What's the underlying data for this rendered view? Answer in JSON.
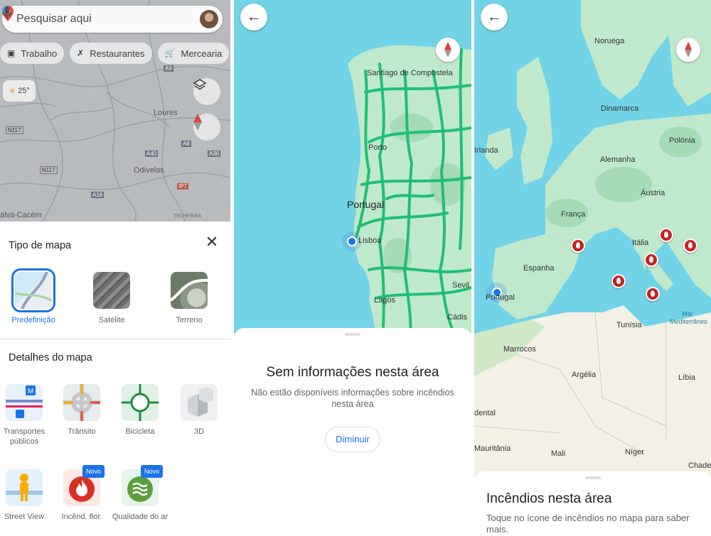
{
  "panel1": {
    "search_placeholder": "Pesquisar aqui",
    "chips": [
      {
        "icon": "briefcase-icon",
        "label": "Trabalho"
      },
      {
        "icon": "restaurant-icon",
        "label": "Restaurantes"
      },
      {
        "icon": "cart-icon",
        "label": "Mercearia"
      }
    ],
    "temperature": "25°",
    "map_labels": {
      "a9": "A9",
      "loures": "Loures",
      "n117a": "N117",
      "a40": "A40",
      "a8": "A8",
      "a36": "A36",
      "n117b": "N117",
      "odivelas": "Odivelas",
      "a16": "A16",
      "ip7": "IP7",
      "cacem": "alva-Cacém",
      "telheiras": "TELHEIRAS"
    },
    "map_type_title": "Tipo de mapa",
    "map_types": [
      {
        "label": "Predefinição",
        "selected": true
      },
      {
        "label": "Satélite",
        "selected": false
      },
      {
        "label": "Terreno",
        "selected": false
      }
    ],
    "map_details_title": "Detalhes do mapa",
    "details": [
      {
        "label": "Transportes públicos"
      },
      {
        "label": "Trânsito"
      },
      {
        "label": "Bicicleta"
      },
      {
        "label": "3D"
      },
      {
        "label": "Street View"
      },
      {
        "label": "Incênd. flor.",
        "badge": "Novo"
      },
      {
        "label": "Qualidade do ar",
        "badge": "Novo"
      }
    ]
  },
  "panel2": {
    "labels": {
      "santiago": "Santiago de Compostela",
      "porto": "Porto",
      "portugal": "Portugal",
      "lisboa": "Lisboa",
      "lagos": "Lagos",
      "sevilla": "Sevil",
      "cadiz": "Cádis"
    },
    "sheet_title": "Sem informações nesta área",
    "sheet_text": "Não estão disponíveis informações sobre incêndios nesta área",
    "zoom_out": "Diminuir"
  },
  "panel3": {
    "labels": {
      "noruega": "Noruega",
      "dinamarca": "Dinamarca",
      "irlanda": "Irlanda",
      "polonia": "Polónia",
      "alemanha": "Alemanha",
      "austria": "Áustria",
      "franca": "França",
      "italia": "Itália",
      "espanha": "Espanha",
      "portugal": "Portugal",
      "tunisia": "Tunísia",
      "marrocos": "Marrocos",
      "argelia": "Argélia",
      "libia": "Líbia",
      "dental": "dental",
      "mauritania": "Mauritânia",
      "mali": "Mali",
      "niger": "Níger",
      "chade": "Chade",
      "mar": "Mar Mediterrâneo"
    },
    "sheet_title": "Incêndios nesta área",
    "sheet_text": "Toque no ícone de incêndios no mapa para saber mais."
  },
  "colors": {
    "accent": "#1a73e8",
    "sea": "#73d3e6",
    "land": "#bfe8cc",
    "fire": "#c5221f",
    "traffic": "#1fbf72"
  }
}
